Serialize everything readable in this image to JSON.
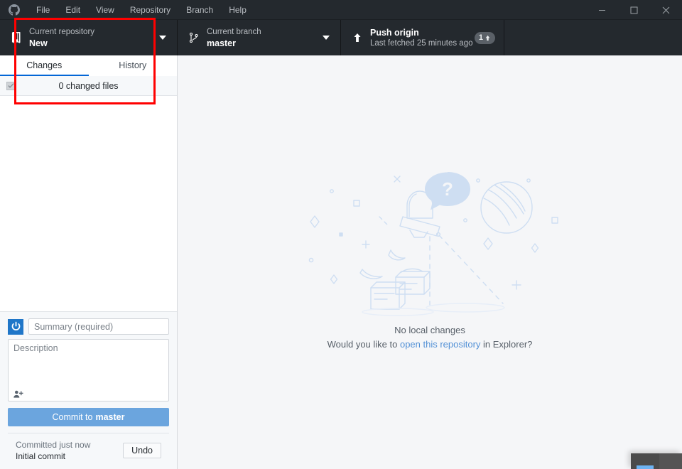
{
  "window": {
    "app_logo_icon": "github-mark-icon",
    "menu": [
      {
        "label": "File",
        "name": "menu-file"
      },
      {
        "label": "Edit",
        "name": "menu-edit"
      },
      {
        "label": "View",
        "name": "menu-view"
      },
      {
        "label": "Repository",
        "name": "menu-repository"
      },
      {
        "label": "Branch",
        "name": "menu-branch"
      },
      {
        "label": "Help",
        "name": "menu-help"
      }
    ],
    "controls": {
      "minimize_icon": "minimize-icon",
      "maximize_icon": "maximize-icon",
      "close_icon": "close-icon"
    }
  },
  "toolbar": {
    "repository": {
      "icon": "repo-book-icon",
      "label": "Current repository",
      "value": "New",
      "caret_icon": "chevron-down-icon"
    },
    "branch": {
      "icon": "git-branch-icon",
      "label": "Current branch",
      "value": "master",
      "caret_icon": "chevron-down-icon"
    },
    "push": {
      "icon": "arrow-up-icon",
      "label": "Push origin",
      "sublabel": "Last fetched 25 minutes ago",
      "badge_count": "1",
      "badge_icon": "arrow-up-small-icon"
    }
  },
  "sidebar": {
    "tabs": [
      {
        "label": "Changes",
        "name": "tab-changes",
        "active": true
      },
      {
        "label": "History",
        "name": "tab-history",
        "active": false
      }
    ],
    "changes_header": {
      "checkbox_icon": "checkbox-checked-icon",
      "title": "0 changed files"
    },
    "commit": {
      "avatar_icon": "github-avatar-icon",
      "summary_placeholder": "Summary (required)",
      "summary_value": "",
      "description_placeholder": "Description",
      "description_value": "",
      "coauthor_icon": "add-person-icon",
      "commit_button_prefix": "Commit to",
      "commit_button_branch": "master"
    },
    "undo_bar": {
      "status": "Committed just now",
      "commit_title": "Initial commit",
      "undo_label": "Undo"
    }
  },
  "main": {
    "illustration_name": "no-local-changes-illustration",
    "title": "No local changes",
    "subtitle_before": "Would you like to ",
    "subtitle_link": "open this repository",
    "subtitle_after": " in Explorer?"
  },
  "colors": {
    "toolbar_bg": "#24292e",
    "accent_blue": "#0366d6",
    "commit_button": "#6ba5de",
    "annotation_red": "#ff0000",
    "link_blue": "#5391d6",
    "illustration_blue": "#cedef2"
  }
}
